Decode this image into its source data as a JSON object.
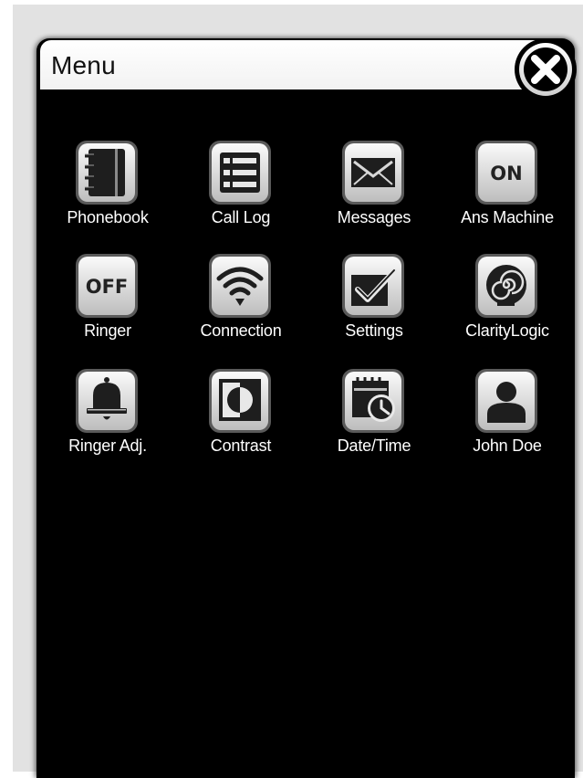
{
  "menu": {
    "title": "Menu",
    "close_icon": "close-x-icon"
  },
  "items": [
    {
      "label": "Phonebook",
      "icon": "phonebook-icon"
    },
    {
      "label": "Call Log",
      "icon": "call-log-icon"
    },
    {
      "label": "Messages",
      "icon": "envelope-icon"
    },
    {
      "label": "Ans Machine",
      "icon": "on-toggle-icon",
      "icon_text": "ON"
    },
    {
      "label": "Ringer",
      "icon": "off-toggle-icon",
      "icon_text": "OFF"
    },
    {
      "label": "Connection",
      "icon": "wifi-icon"
    },
    {
      "label": "Settings",
      "icon": "checkbox-icon"
    },
    {
      "label": "ClarityLogic",
      "icon": "head-spiral-icon"
    },
    {
      "label": "Ringer Adj.",
      "icon": "bell-icon"
    },
    {
      "label": "Contrast",
      "icon": "contrast-icon"
    },
    {
      "label": "Date/Time",
      "icon": "calendar-clock-icon"
    },
    {
      "label": "John Doe",
      "icon": "person-icon"
    }
  ]
}
